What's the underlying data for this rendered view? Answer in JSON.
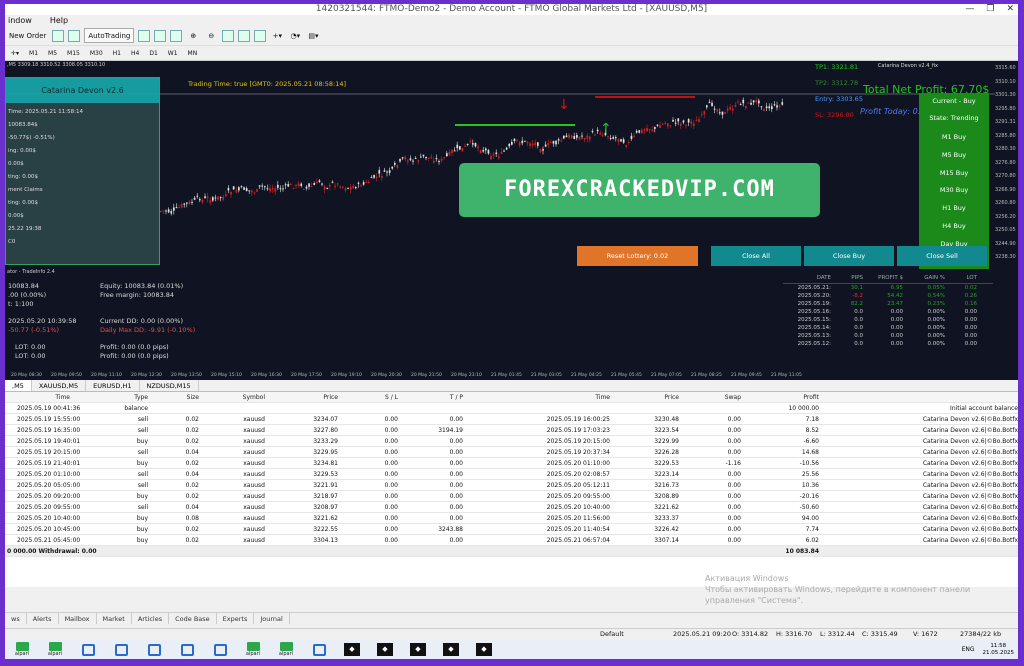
{
  "window": {
    "title": "1420321544: FTMO-Demo2 - Demo Account - FTMO Global Markets Ltd - [XAUUSD,M5]"
  },
  "menu": [
    "indow",
    "Help"
  ],
  "toolbar": {
    "new_order": "New Order",
    "autotrading": "AutoTrading"
  },
  "timeframes": [
    "M1",
    "M5",
    "M15",
    "M30",
    "H1",
    "H4",
    "D1",
    "W1",
    "MN"
  ],
  "chart": {
    "ohlc": ",M5  3309.18 3310.52 3308.05 3310.10",
    "trading_time": "Trading Time: true [GMT0: 2025.05.21 08:58:14]",
    "symbol_label": "Catarina Devon v2.4_fix",
    "panel": {
      "title": "Catarina Devon v2.6",
      "lines": [
        "Time: 2025.05.21 11:58:14",
        "10083.84$",
        "-50.77$) -0.51%)",
        "ing: 0.00$",
        "0.00$",
        "ting: 0.00$",
        "ment Claims",
        "ting: 0.00$",
        "0.00$",
        "25.22 19:38",
        "C0"
      ]
    },
    "total_net_profit": "Total Net Profit: 67.70$",
    "profit_today": "Profit Today: 0.00$ 0.00%",
    "entry": "Entry: 3303.65",
    "tp1": "TP1: 3321.81",
    "tp2": "TP2: 3312.78",
    "sl": "SL: 3296.80",
    "current": "Current - Buy",
    "state": "State: Trending",
    "tf_buttons": [
      "M1 Buy",
      "M5 Buy",
      "M15 Buy",
      "M30 Buy",
      "H1 Buy",
      "H4 Buy",
      "Day Buy"
    ],
    "reset_lottery": "Reset Lottery: 0.02",
    "close_all": "Close All",
    "close_buy": "Close Buy",
    "close_sell": "Close Sell",
    "watermark": "FOREXCRACKEDVIP.COM",
    "price_ticks": [
      "3315.60",
      "3310.10",
      "3301.30",
      "3295.80",
      "3291.31",
      "3285.80",
      "3280.30",
      "3276.80",
      "3270.80",
      "3266.90",
      "3260.80",
      "3256.20",
      "3250.05",
      "3244.90",
      "3238.30"
    ]
  },
  "indicator": {
    "header": "ator - TradeInfo 2.4",
    "balance": "10083.84",
    "line2": ".00 (0.00%)",
    "line3": "t: 1:100",
    "equity": "Equity: 10083.84 (0.01%)",
    "free_margin": "Free margin: 10083.84",
    "date": "2025.05.20 10:39:58",
    "dd_left": "-50.77 (-0.51%)",
    "current_dd": "Current   DD: 0.00  (0.00%)",
    "daily_dd": "Daily Max DD: -9.91  (-0.10%)",
    "lot1": "LOT: 0.00",
    "lot2": "LOT: 0.00",
    "profit1": "Profit: 0.00  (0.0 pips)",
    "profit2": "Profit: 0.00  (0.0 pips)",
    "hist_headers": [
      "DATE",
      "PIPS",
      "PROFIT $",
      "GAIN %",
      "LOT"
    ],
    "hist_rows": [
      [
        "2025.05.21:",
        "30.1",
        "6.95",
        "0.05%",
        "0.02"
      ],
      [
        "2025.05.20:",
        "-8.2",
        "54.42",
        "0.54%",
        "0.26"
      ],
      [
        "2025.05.19:",
        "82.2",
        "23.47",
        "0.23%",
        "0.16"
      ],
      [
        "2025.05.16:",
        "0.0",
        "0.00",
        "0.00%",
        "0.00"
      ],
      [
        "2025.05.15:",
        "0.0",
        "0.00",
        "0.00%",
        "0.00"
      ],
      [
        "2025.05.14:",
        "0.0",
        "0.00",
        "0.00%",
        "0.00"
      ],
      [
        "2025.05.13:",
        "0.0",
        "0.00",
        "0.00%",
        "0.00"
      ],
      [
        "2025.05.12:",
        "0.0",
        "0.00",
        "0.00%",
        "0.00"
      ]
    ]
  },
  "time_axis": [
    "20 May 08:30",
    "20 May 09:50",
    "20 May 11:10",
    "20 May 12:30",
    "20 May 13:50",
    "20 May 15:10",
    "20 May 16:30",
    "20 May 17:50",
    "20 May 19:10",
    "20 May 20:30",
    "20 May 21:50",
    "20 May 23:10",
    "21 May 01:45",
    "21 May 03:05",
    "21 May 04:25",
    "21 May 05:45",
    "21 May 07:05",
    "21 May 08:25",
    "21 May 09:45",
    "21 May 11:05"
  ],
  "chart_tabs": [
    ",M5",
    "XAUUSD,M5",
    "EURUSD,H1",
    "NZDUSD,M15"
  ],
  "table": {
    "headers": [
      "Time",
      "Type",
      "Size",
      "Symbol",
      "Price",
      "S / L",
      "T / P",
      "Time",
      "Price",
      "Swap",
      "Profit",
      ""
    ],
    "rows": [
      [
        "2025.05.19 00:41:36",
        "balance",
        "",
        "",
        "",
        "",
        "",
        "",
        "",
        "",
        "10 000.00",
        "Initial account balance"
      ],
      [
        "2025.05.19 15:55:00",
        "sell",
        "0.02",
        "xauusd",
        "3234.07",
        "0.00",
        "0.00",
        "2025.05.19 16:00:25",
        "3230.48",
        "0.00",
        "7.18",
        "Catarina Devon v2.6|©Bo.Botfx"
      ],
      [
        "2025.05.19 16:35:00",
        "sell",
        "0.02",
        "xauusd",
        "3227.80",
        "0.00",
        "3194.19",
        "2025.05.19 17:03:23",
        "3223.54",
        "0.00",
        "8.52",
        "Catarina Devon v2.6|©Bo.Botfx"
      ],
      [
        "2025.05.19 19:40:01",
        "buy",
        "0.02",
        "xauusd",
        "3233.29",
        "0.00",
        "0.00",
        "2025.05.19 20:15:00",
        "3229.99",
        "0.00",
        "-6.60",
        "Catarina Devon v2.6|©Bo.Botfx"
      ],
      [
        "2025.05.19 20:15:00",
        "sell",
        "0.04",
        "xauusd",
        "3229.95",
        "0.00",
        "0.00",
        "2025.05.19 20:37:34",
        "3226.28",
        "0.00",
        "14.68",
        "Catarina Devon v2.6|©Bo.Botfx"
      ],
      [
        "2025.05.19 21:40:01",
        "buy",
        "0.02",
        "xauusd",
        "3234.81",
        "0.00",
        "0.00",
        "2025.05.20 01:10:00",
        "3229.53",
        "-1.16",
        "-10.56",
        "Catarina Devon v2.6|©Bo.Botfx"
      ],
      [
        "2025.05.20 01:10:00",
        "sell",
        "0.04",
        "xauusd",
        "3229.53",
        "0.00",
        "0.00",
        "2025.05.20 02:08:57",
        "3223.14",
        "0.00",
        "25.56",
        "Catarina Devon v2.6|©Bo.Botfx"
      ],
      [
        "2025.05.20 05:05:00",
        "sell",
        "0.02",
        "xauusd",
        "3221.91",
        "0.00",
        "0.00",
        "2025.05.20 05:12:11",
        "3216.73",
        "0.00",
        "10.36",
        "Catarina Devon v2.6|©Bo.Botfx"
      ],
      [
        "2025.05.20 09:20:00",
        "buy",
        "0.02",
        "xauusd",
        "3218.97",
        "0.00",
        "0.00",
        "2025.05.20 09:55:00",
        "3208.89",
        "0.00",
        "-20.16",
        "Catarina Devon v2.6|©Bo.Botfx"
      ],
      [
        "2025.05.20 09:55:00",
        "sell",
        "0.04",
        "xauusd",
        "3208.97",
        "0.00",
        "0.00",
        "2025.05.20 10:40:00",
        "3221.62",
        "0.00",
        "-50.60",
        "Catarina Devon v2.6|©Bo.Botfx"
      ],
      [
        "2025.05.20 10:40:00",
        "buy",
        "0.08",
        "xauusd",
        "3221.62",
        "0.00",
        "0.00",
        "2025.05.20 11:56:00",
        "3233.37",
        "0.00",
        "94.00",
        "Catarina Devon v2.6|©Bo.Botfx"
      ],
      [
        "2025.05.20 10:45:00",
        "buy",
        "0.02",
        "xauusd",
        "3222.55",
        "0.00",
        "3243.88",
        "2025.05.20 11:40:54",
        "3226.42",
        "0.00",
        "7.74",
        "Catarina Devon v2.6|©Bo.Botfx"
      ],
      [
        "2025.05.21 05:45:00",
        "buy",
        "0.02",
        "xauusd",
        "3304.13",
        "0.00",
        "0.00",
        "2025.05.21 06:57:04",
        "3307.14",
        "0.00",
        "6.02",
        "Catarina Devon v2.6|©Bo.Botfx"
      ]
    ],
    "total_left": "0 000.00  Withdrawal: 0.00",
    "total_profit": "10 083.84"
  },
  "activation": {
    "line1": "Активация Windows",
    "line2": "Чтобы активировать Windows, перейдите в компонент панели",
    "line3": "управления \"Система\"."
  },
  "bottom_tabs": [
    "ws",
    "Alerts",
    "Mailbox",
    "Market",
    "Articles",
    "Code Base",
    "Experts",
    "Journal"
  ],
  "status": {
    "profile": "Default",
    "datetime": "2025.05.21 09:20",
    "open": "O: 3314.82",
    "high": "H: 3316.70",
    "low": "L: 3312.44",
    "close": "C: 3315.49",
    "volume": "V: 1672",
    "traffic": "27384/22 kb"
  },
  "taskbar": {
    "apps": [
      "alpari",
      "alpari",
      "",
      "",
      "",
      "",
      "",
      "alpari",
      "alpari",
      "",
      "",
      "",
      "",
      "",
      ""
    ],
    "lang": "ENG",
    "time": "11:58",
    "date": "21.05.2025"
  },
  "colors": {
    "chart_bg": "#101422",
    "buy_green": "#1ec81e",
    "accent_teal": "#17a3a7",
    "sell_red": "#e01010",
    "purple_frame": "#6b2fd0"
  }
}
